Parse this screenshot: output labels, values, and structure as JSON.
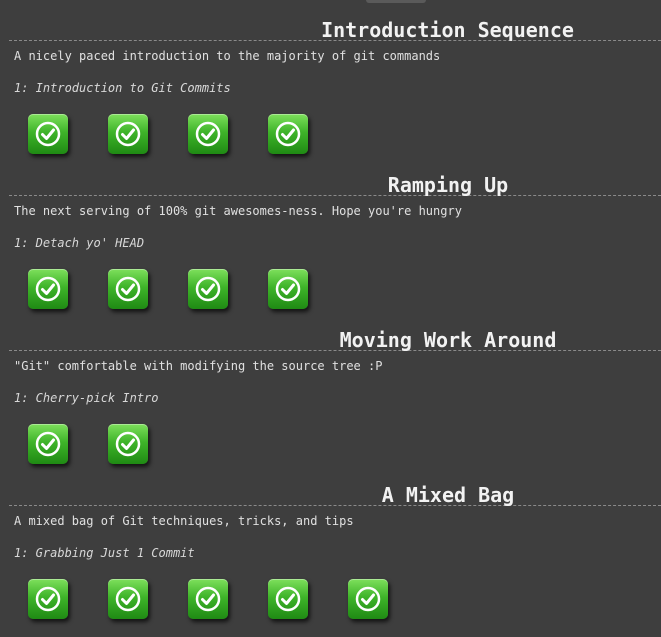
{
  "sequences": [
    {
      "title": "Introduction Sequence",
      "about": "A nicely paced introduction to the majority of git commands",
      "level_name": "1: Introduction to Git Commits",
      "levels": [
        {
          "icon": "checkmark-icon",
          "completed": true
        },
        {
          "icon": "checkmark-icon",
          "completed": true
        },
        {
          "icon": "checkmark-icon",
          "completed": true
        },
        {
          "icon": "checkmark-icon",
          "completed": true
        }
      ]
    },
    {
      "title": "Ramping Up",
      "about": "The next serving of 100% git awesomes-ness. Hope you're hungry",
      "level_name": "1: Detach yo' HEAD",
      "levels": [
        {
          "icon": "checkmark-icon",
          "completed": true
        },
        {
          "icon": "checkmark-icon",
          "completed": true
        },
        {
          "icon": "checkmark-icon",
          "completed": true
        },
        {
          "icon": "checkmark-icon",
          "completed": true
        }
      ]
    },
    {
      "title": "Moving Work Around",
      "about": "\"Git\" comfortable with modifying the source tree :P",
      "level_name": "1: Cherry-pick Intro",
      "levels": [
        {
          "icon": "checkmark-icon",
          "completed": true
        },
        {
          "icon": "checkmark-icon",
          "completed": true
        }
      ]
    },
    {
      "title": "A Mixed Bag",
      "about": "A mixed bag of Git techniques, tricks, and tips",
      "level_name": "1: Grabbing Just 1 Commit",
      "levels": [
        {
          "icon": "checkmark-icon",
          "completed": true
        },
        {
          "icon": "checkmark-icon",
          "completed": true
        },
        {
          "icon": "checkmark-icon",
          "completed": true
        },
        {
          "icon": "checkmark-icon",
          "completed": true
        },
        {
          "icon": "checkmark-icon",
          "completed": true
        }
      ]
    }
  ],
  "colors": {
    "background": "#3e3e3e",
    "completed_button": "#3fb42a"
  }
}
